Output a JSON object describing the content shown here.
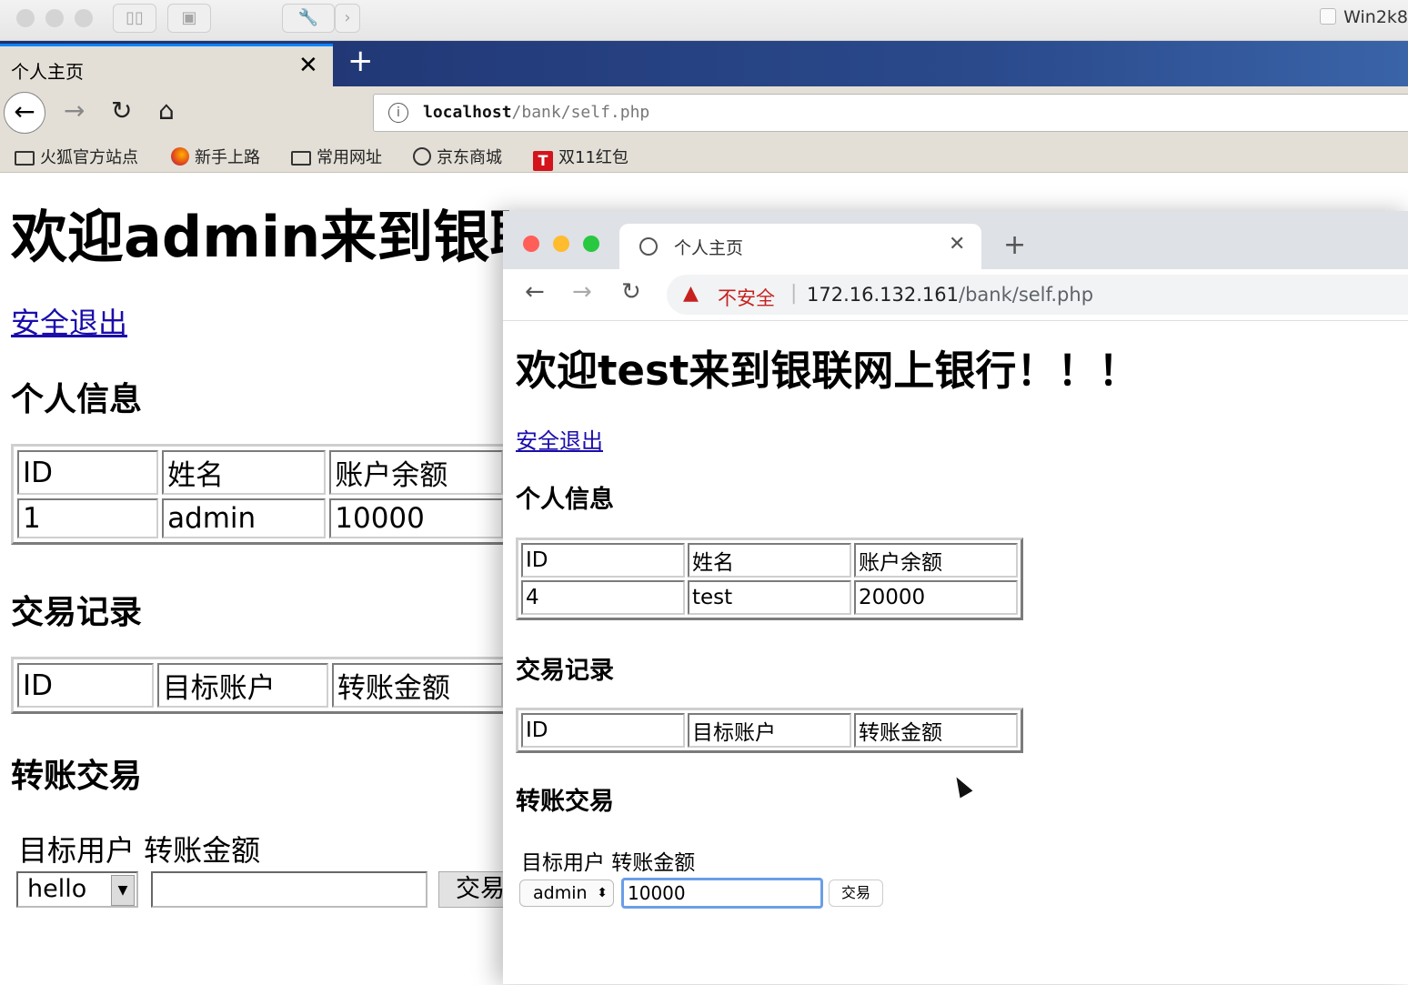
{
  "host": {
    "vm_label": "Win2k8"
  },
  "firefox": {
    "tab_title": "个人主页",
    "tab_close": "✕",
    "new_tab": "+",
    "url_host": "localhost",
    "url_path": "/bank/self.php",
    "bookmarks": [
      "火狐官方站点",
      "新手上路",
      "常用网址",
      "京东商城",
      "双11红包"
    ],
    "page": {
      "heading": "欢迎admin来到银联网上银行！！！",
      "logout": "安全退出",
      "section_info": "个人信息",
      "info_headers": [
        "ID",
        "姓名",
        "账户余额"
      ],
      "info_row": [
        "1",
        "admin",
        "10000"
      ],
      "section_tx": "交易记录",
      "tx_headers": [
        "ID",
        "目标账户",
        "转账金额"
      ],
      "section_transfer": "转账交易",
      "form_label": "目标用户 转账金额",
      "select_value": "hello",
      "amount_value": "",
      "submit_label": "交易"
    }
  },
  "chrome": {
    "tab_title": "个人主页",
    "tab_close": "✕",
    "new_tab": "+",
    "security_label": "不安全",
    "url_host": "172.16.132.161",
    "url_path": "/bank/self.php",
    "page": {
      "heading": "欢迎test来到银联网上银行！！！",
      "logout": "安全退出",
      "section_info": "个人信息",
      "info_headers": [
        "ID",
        "姓名",
        "账户余额"
      ],
      "info_row": [
        "4",
        "test",
        "20000"
      ],
      "section_tx": "交易记录",
      "tx_headers": [
        "ID",
        "目标账户",
        "转账金额"
      ],
      "section_transfer": "转账交易",
      "form_label": "目标用户 转账金额",
      "select_value": "admin",
      "amount_value": "10000",
      "submit_label": "交易"
    }
  }
}
